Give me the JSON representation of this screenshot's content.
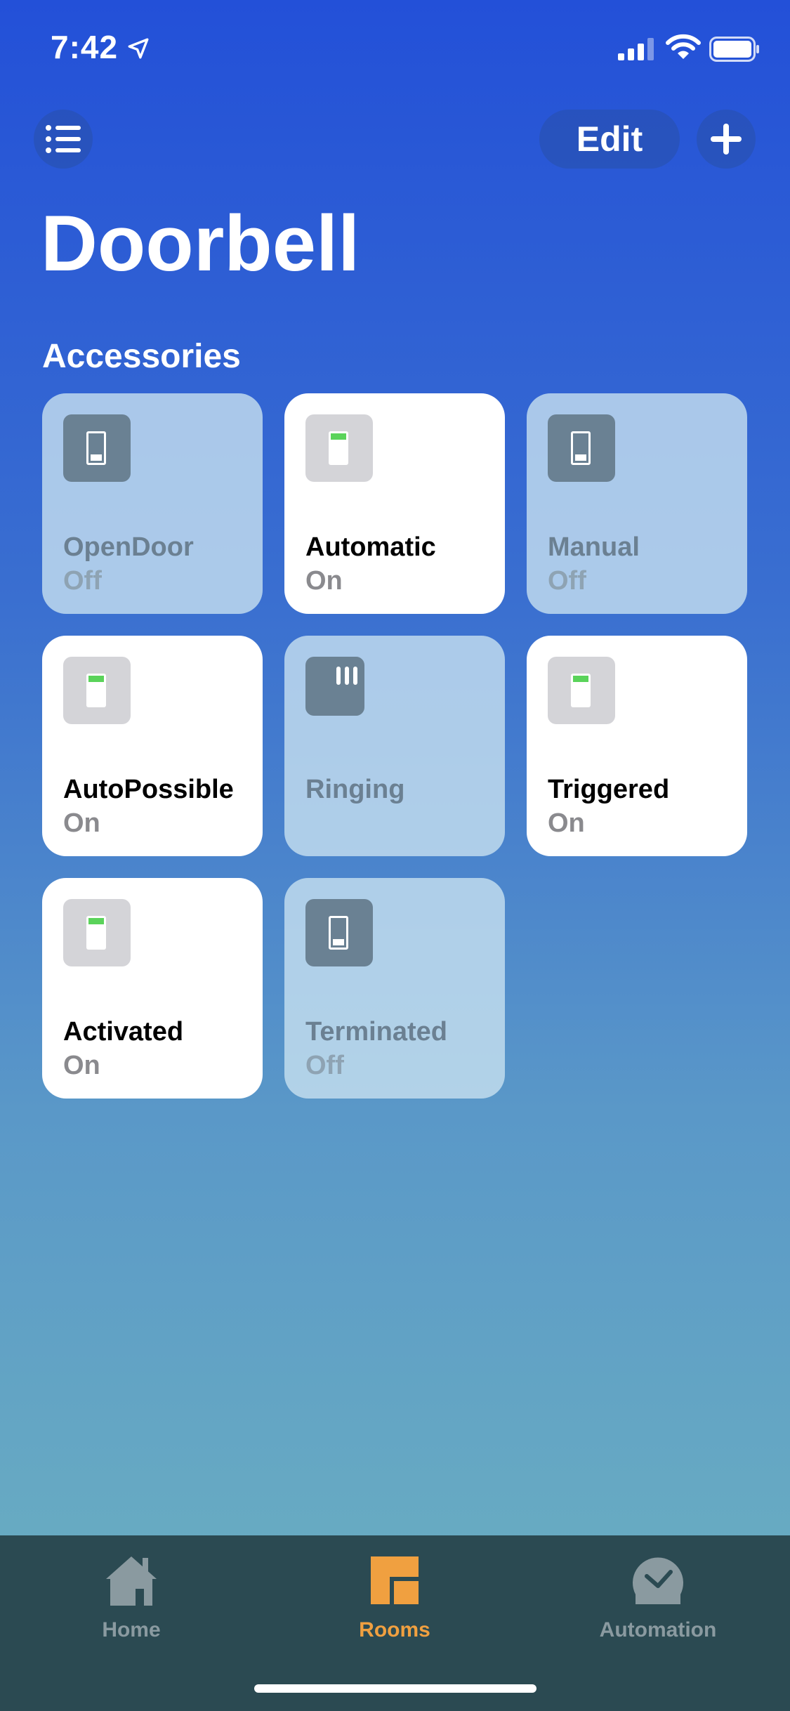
{
  "status_bar": {
    "time": "7:42"
  },
  "header": {
    "edit_label": "Edit",
    "title": "Doorbell"
  },
  "section_title": "Accessories",
  "accessories": [
    {
      "name": "OpenDoor",
      "state": "Off"
    },
    {
      "name": "Automatic",
      "state": "On"
    },
    {
      "name": "Manual",
      "state": "Off"
    },
    {
      "name": "AutoPossible",
      "state": "On"
    },
    {
      "name": "Ringing",
      "state": ""
    },
    {
      "name": "Triggered",
      "state": "On"
    },
    {
      "name": "Activated",
      "state": "On"
    },
    {
      "name": "Terminated",
      "state": "Off"
    }
  ],
  "tab_bar": {
    "items": [
      {
        "label": "Home",
        "icon": "house-icon",
        "color": "#8a9aa0"
      },
      {
        "label": "Rooms",
        "icon": "room-icon",
        "color": "#f0a040",
        "selected": true
      },
      {
        "label": "Automation",
        "icon": "checkmark-circle-icon",
        "color": "#8a9aa0"
      }
    ]
  },
  "colors": {
    "accent": "#f0a040",
    "switch_on_indicator": "#5ad35a",
    "tab_bar_bg": "#2b4a52"
  }
}
